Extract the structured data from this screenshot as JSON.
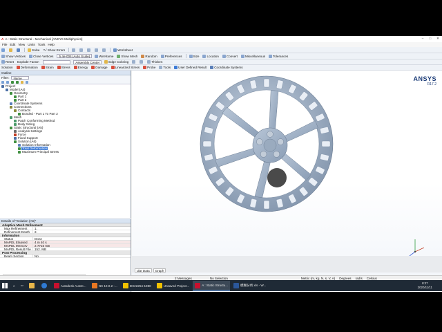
{
  "window": {
    "title": "A : Static Structural - Mechanical [ANSYS Multiphysics]"
  },
  "menu": [
    "File",
    "Edit",
    "View",
    "Units",
    "Tools",
    "Help"
  ],
  "toolbar1": {
    "solve": "Solve",
    "show_errors": "?√ Show Errors",
    "worksheet": "Worksheet"
  },
  "toolbar2": {
    "show_vertices": "Show Vertices",
    "close_vertices": "Close Vertices",
    "auto_scale": "5.4e-004 (Auto Scale)",
    "wireframe": "Wireframe",
    "show_mesh": "Show Mesh",
    "random": "Random",
    "preferences": "Preferences",
    "size": "Size",
    "location": "Location",
    "convert": "Convert",
    "miscellaneous": "Miscellaneous",
    "tolerances": "Tolerances"
  },
  "toolbar3": {
    "reset": "Reset",
    "explode_factor": "Explode Factor:",
    "assembly_center": "Assembly Center",
    "edge_coloring": "Edge Coloring",
    "thicken": "Thicken"
  },
  "toolbar4": {
    "solution": "Solution",
    "deformation": "Deformation",
    "strain": "Strain",
    "stress": "Stress",
    "energy": "Energy",
    "damage": "Damage",
    "linearized_stress": "Linearized Stress",
    "probe": "Probe",
    "tools": "Tools",
    "user_defined_result": "User Defined Result",
    "coordinate_systems": "Coordinate Systems"
  },
  "outline": {
    "title": "Outline",
    "filter_label": "Filter:",
    "filter_value": "Name",
    "tree": [
      {
        "label": "Project",
        "depth": 0,
        "color": "#4a6fa5"
      },
      {
        "label": "Model (A4)",
        "depth": 1,
        "color": "#4a6fa5"
      },
      {
        "label": "Geometry",
        "depth": 2,
        "color": "#3f8f3f"
      },
      {
        "label": "Part 1",
        "depth": 3,
        "color": "#3f8f3f"
      },
      {
        "label": "Part 2",
        "depth": 3,
        "color": "#3f8f3f"
      },
      {
        "label": "Coordinate Systems",
        "depth": 2,
        "color": "#5a7fb8"
      },
      {
        "label": "Connections",
        "depth": 2,
        "color": "#8a8a3a"
      },
      {
        "label": "Contacts",
        "depth": 3,
        "color": "#8a8a3a"
      },
      {
        "label": "Bonded - Part 1 To Part 2",
        "depth": 4,
        "color": "#3f8f3f"
      },
      {
        "label": "Mesh",
        "depth": 2,
        "color": "#4b9b6b"
      },
      {
        "label": "Patch Conforming Method",
        "depth": 3,
        "color": "#4b9b6b"
      },
      {
        "label": "Body Sizing",
        "depth": 3,
        "color": "#4b9b6b"
      },
      {
        "label": "Static Structural (A5)",
        "depth": 2,
        "color": "#3f8f3f"
      },
      {
        "label": "Analysis Settings",
        "depth": 3,
        "color": "#6b6b6b"
      },
      {
        "label": "Force",
        "depth": 3,
        "color": "#c23b22"
      },
      {
        "label": "Fixed Support",
        "depth": 3,
        "color": "#4a6fa5"
      },
      {
        "label": "Solution (A6)",
        "depth": 3,
        "color": "#3f8f3f"
      },
      {
        "label": "Solution Information",
        "depth": 4,
        "color": "#5a7fb8"
      },
      {
        "label": "Total Deformation",
        "depth": 4,
        "color": "#3f8f3f",
        "selected": true
      },
      {
        "label": "Maximum Principal Stress",
        "depth": 4,
        "color": "#3f8f3f"
      }
    ]
  },
  "details": {
    "title": "Details of \"Solution (A6)\"",
    "groups": [
      {
        "name": "Adaptive Mesh Refinement",
        "rows": [
          {
            "k": "Max Refinement Loops",
            "v": "1."
          },
          {
            "k": "Refinement Depth",
            "v": "2."
          }
        ]
      },
      {
        "name": "Information",
        "rows": [
          {
            "k": "Status",
            "v": "Done",
            "hl": false
          },
          {
            "k": "MAPDL Elapsed Time",
            "v": "4 m 40 s",
            "hl": true
          },
          {
            "k": "MAPDL Memory Used",
            "v": "2.7715 GB",
            "hl": true
          },
          {
            "k": "MAPDL Result File Size",
            "v": "152. MB",
            "hl": false
          }
        ]
      },
      {
        "name": "Post Processing",
        "rows": [
          {
            "k": "Beam Section Results",
            "v": "No",
            "hl": false
          }
        ]
      }
    ]
  },
  "viewport": {
    "brand": "ANSYS",
    "version": "R17.2",
    "scale_top": [
      "0.000",
      "0.150",
      "0.300 (m)"
    ],
    "scale_bottom": [
      "0.075",
      "0.225"
    ],
    "tabs": [
      "Geometry",
      "Print Preview",
      "Report Preview"
    ],
    "graph_title": "Graph"
  },
  "lower_tabs": [
    "ular Data",
    "Graph"
  ],
  "status": {
    "messages": "2 Messages",
    "selection": "No Selection",
    "units": "Metric (m, kg, N, s, V, A)",
    "degrees": "Degrees",
    "rads": "rad/s",
    "celsius": "Celsius"
  },
  "taskbar": {
    "apps": [
      {
        "label": "Autodesk AutoC...",
        "color": "#c8102e"
      },
      {
        "label": "NX 10.0.2 -...",
        "color": "#e87722"
      },
      {
        "label": "DX22254-1980",
        "color": "#f2c200"
      },
      {
        "label": "Unsaved Project...",
        "color": "#f2c200"
      },
      {
        "label": "A : Static Structu...",
        "color": "#c8102e",
        "active": true
      },
      {
        "label": "模糊分析.xls - W...",
        "color": "#2b579a"
      }
    ],
    "time": "8:27",
    "date": "2020/11/11"
  },
  "colors": {
    "wheel": "#9fb0c4",
    "wheel_dark": "#7f93aa",
    "accent": "#3d7bd6"
  }
}
